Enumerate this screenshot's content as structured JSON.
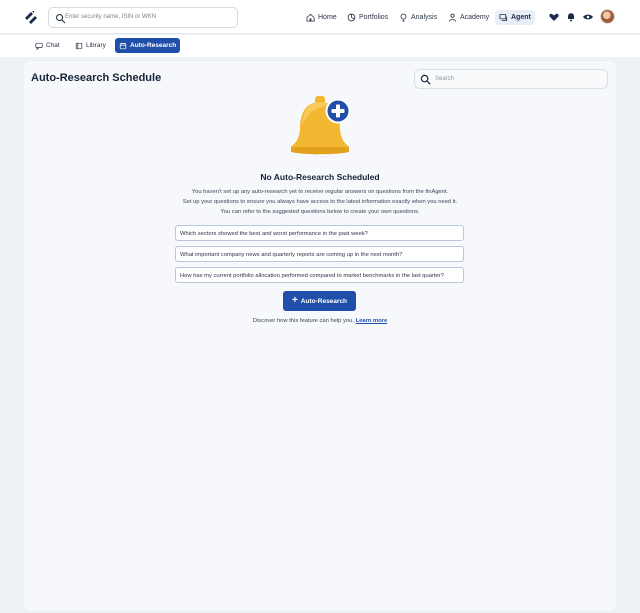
{
  "header": {
    "search_placeholder": "Enter security name, ISIN or WKN",
    "nav": [
      {
        "label": "Home",
        "icon": "home-icon"
      },
      {
        "label": "Portfolios",
        "icon": "pie-chart-icon"
      },
      {
        "label": "Analysis",
        "icon": "lightbulb-icon"
      },
      {
        "label": "Academy",
        "icon": "academy-icon"
      },
      {
        "label": "Agent",
        "icon": "agent-chat-icon"
      }
    ],
    "active_nav": "Agent",
    "utility_icons": [
      "heart-icon",
      "bell-icon",
      "eye-icon"
    ]
  },
  "tabs": [
    {
      "label": "Chat",
      "icon": "chat-icon"
    },
    {
      "label": "Library",
      "icon": "library-icon"
    },
    {
      "label": "Auto-Research",
      "icon": "calendar-icon"
    }
  ],
  "active_tab": "Auto-Research",
  "main": {
    "title": "Auto-Research Schedule",
    "search_placeholder": "Search",
    "empty_title": "No Auto-Research Scheduled",
    "description": [
      "You haven't set up any auto-research yet to receive regular answers on questions from the finAgent.",
      "Set up your questions to ensure you always have access to the latest information exactly when you need it.",
      "You can refer to the suggested questions below to create your own questions."
    ],
    "questions": [
      "Which sectors showed the best and worst performance in the past week?",
      "What important company news and quarterly reports are coming up in the next month?",
      "How has my current portfolio allocation performed compared to market benchmarks in the last quarter?"
    ],
    "cta_label": "Auto-Research",
    "discover_text": "Discover how this feature can help you.",
    "learn_more": "Learn more"
  },
  "colors": {
    "accent": "#1f4fa8",
    "bell": "#f4b731",
    "background": "#eef1f5"
  }
}
